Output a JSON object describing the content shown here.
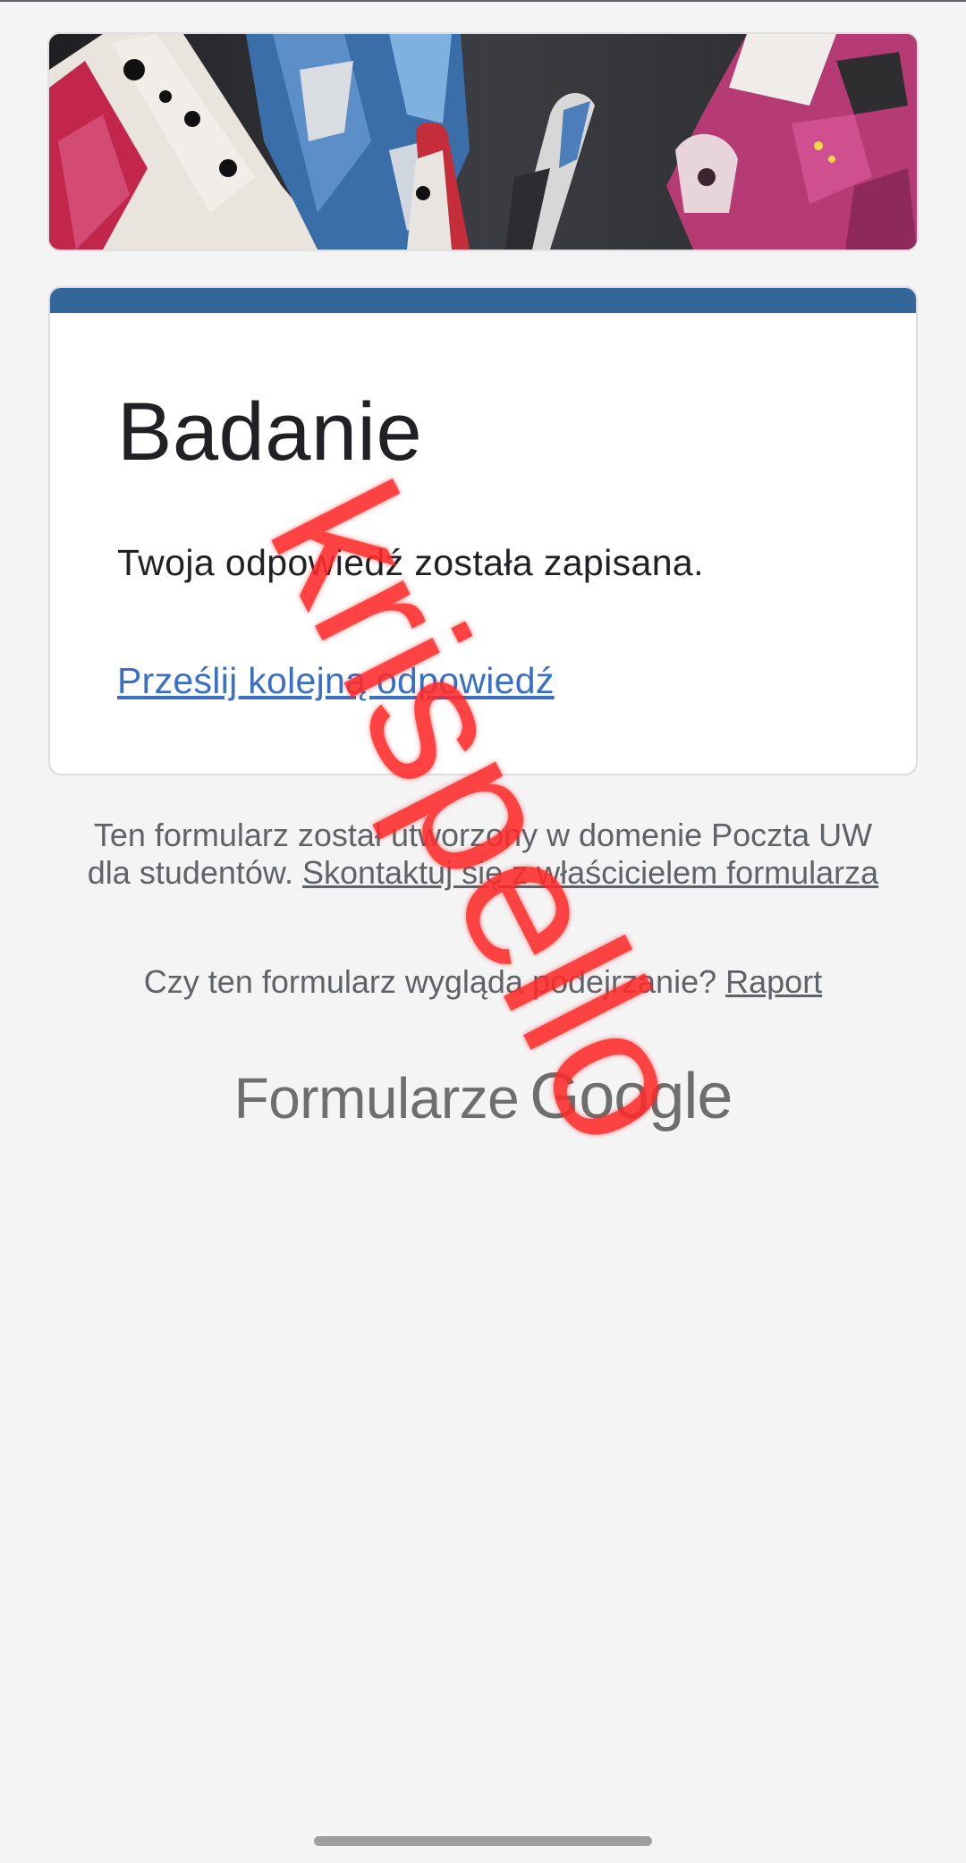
{
  "form": {
    "title": "Badanie",
    "confirmation": "Twoja odpowiedź została zapisana.",
    "submit_another": "Prześlij kolejną odpowiedź",
    "accent_color": "#336699"
  },
  "footer": {
    "domain_text": "Ten formularz został utworzony w domenie Poczta UW dla studentów.",
    "contact_owner": "Skontaktuj się z właścicielem formularza",
    "abuse_text": "Czy ten formularz wygląda podejrzanie?",
    "report": "Raport",
    "brand_forms": "Formularze",
    "brand_google": "Google"
  },
  "watermark": {
    "text": "krispello",
    "color": "#ff2a2a"
  },
  "banner": {
    "icon": "painted-hands-image"
  }
}
